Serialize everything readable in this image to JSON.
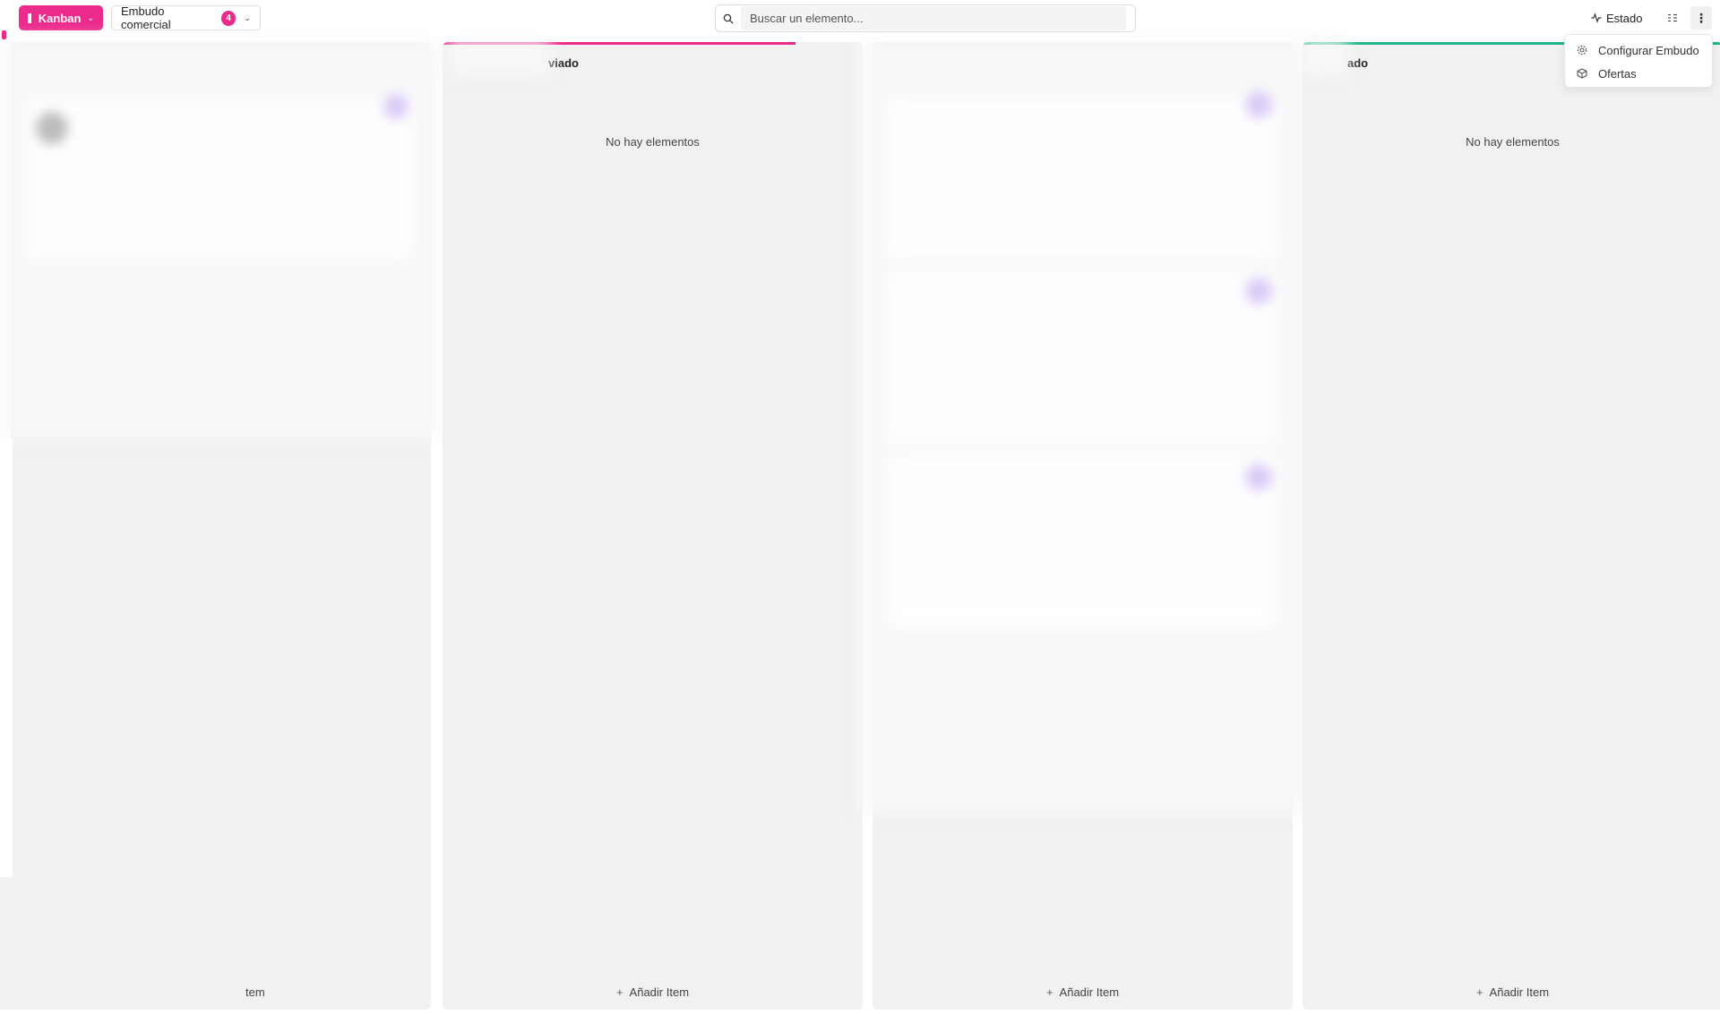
{
  "toolbar": {
    "view_label": "Kanban",
    "pipeline_label": "Embudo comercial",
    "pipeline_count": "4",
    "search_placeholder": "Buscar un elemento...",
    "status_label": "Estado"
  },
  "columns": [
    {
      "title": "",
      "empty_text": "",
      "add_label": "tem"
    },
    {
      "title": "viado",
      "empty_text": "No hay elementos",
      "add_label": "Añadir Item",
      "accent": "#ec2a8c"
    },
    {
      "title": "",
      "empty_text": "",
      "add_label": "Añadir Item"
    },
    {
      "title": "ado",
      "empty_text": "No hay elementos",
      "add_label": "Añadir Item",
      "accent": "#1fb58a"
    }
  ],
  "menu": {
    "items": [
      {
        "label": "Configurar Embudo",
        "icon": "gear-icon"
      },
      {
        "label": "Ofertas",
        "icon": "box-icon"
      }
    ]
  },
  "colors": {
    "brand": "#ec2a8c",
    "success": "#1fb58a"
  }
}
